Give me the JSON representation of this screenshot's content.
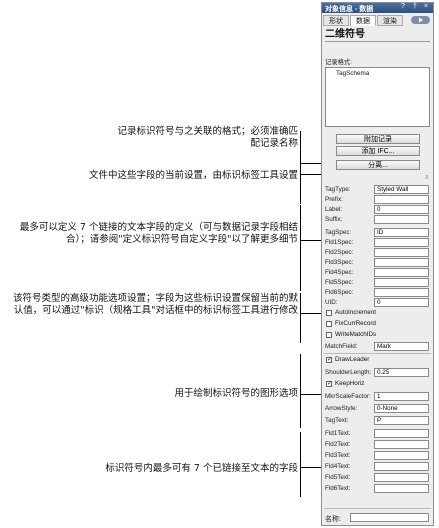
{
  "annotations": [
    {
      "text": "记录标识符号与之关联的格式；必须准确匹配记录名称"
    },
    {
      "text": "文件中这些字段的当前设置，由标识标签工具设置"
    },
    {
      "text": "最多可以定义 7 个链接的文本字段的定义（可与数据记录字段相结合）；请参阅\"定义标识符号自定义字段\"以了解更多细节"
    },
    {
      "text": "该符号类型的高级功能选项设置；字段为这些标识设置保留当前的默认值，可以通过\"标识（规格工具\"对话框中的标识标签工具进行修改"
    },
    {
      "text": "用于绘制标识符号的图形选项"
    },
    {
      "text": "标识符号内最多可有 7 个已链接至文本的字段"
    }
  ],
  "palette": {
    "title": "对象信息 - 数据",
    "title_buttons": [
      "?",
      "†",
      "×"
    ],
    "tabs": [
      "形状",
      "数据",
      "渲染"
    ],
    "symbol_title": "二维符号",
    "record_format_label": "记录格式:",
    "record_format_item": "TagSchema",
    "buttons": {
      "attach_record": "附加记录",
      "add_ifc": "添加 IFC...",
      "classify": "分离..."
    },
    "fields": [
      {
        "label": "TagType:",
        "value": "Styled Wall"
      },
      {
        "label": "Prefix:",
        "value": ""
      },
      {
        "label": "Label:",
        "value": "0"
      },
      {
        "label": "Suffix:",
        "value": ""
      },
      {
        "label": "TagSpec:",
        "value": "ID"
      },
      {
        "label": "Fld1Spec:",
        "value": ""
      },
      {
        "label": "Fld2Spec:",
        "value": ""
      },
      {
        "label": "Fld3Spec:",
        "value": ""
      },
      {
        "label": "Fld4Spec:",
        "value": ""
      },
      {
        "label": "Fld5Spec:",
        "value": ""
      },
      {
        "label": "Fld6Spec:",
        "value": ""
      },
      {
        "label": "UID:",
        "value": "0"
      }
    ],
    "advanced_checks": [
      {
        "label": "AutoIncrement",
        "checked": false
      },
      {
        "label": "FixCurrRecord",
        "checked": false
      },
      {
        "label": "WriteMatchIDs",
        "checked": false
      }
    ],
    "match_field": {
      "label": "MatchField:",
      "value": "Mark"
    },
    "graphic_checks": [
      {
        "label": "DrawLeader",
        "checked": true
      }
    ],
    "shoulder": {
      "label": "ShoulderLength:",
      "value": "0.25"
    },
    "keep_horiz": {
      "label": "KeepHoriz",
      "checked": true
    },
    "mkr_scale": {
      "label": "MkrScaleFactor:",
      "value": "1"
    },
    "arrow_style": {
      "label": "ArrowStyle:",
      "value": "0-None"
    },
    "text_fields": [
      {
        "label": "TagText:",
        "value": "P"
      },
      {
        "label": "Fld1Text:",
        "value": ""
      },
      {
        "label": "Fld2Text:",
        "value": ""
      },
      {
        "label": "Fld3Text:",
        "value": ""
      },
      {
        "label": "Fld4Text:",
        "value": ""
      },
      {
        "label": "Fld5Text:",
        "value": ""
      },
      {
        "label": "Fld6Text:",
        "value": ""
      }
    ],
    "name_label": "名称:",
    "name_value": "",
    "colors": {
      "titlebar": "#3a5d8e",
      "panel": "#ededed"
    }
  }
}
